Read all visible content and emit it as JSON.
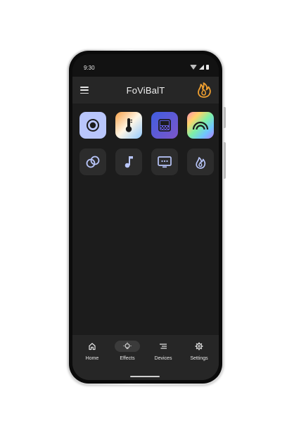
{
  "status_bar": {
    "time": "9:30",
    "icons": [
      "wifi-icon",
      "signal-icon",
      "battery-icon"
    ]
  },
  "app_bar": {
    "title": "FoViBalT",
    "menu_icon": "menu-icon",
    "logo_icon": "flame-logo-icon"
  },
  "effects": [
    {
      "id": "static",
      "icon": "radio-target-icon"
    },
    {
      "id": "color-temperature",
      "icon": "thermometer-icon"
    },
    {
      "id": "gradient",
      "icon": "gradient-icon"
    },
    {
      "id": "rainbow",
      "icon": "rainbow-icon"
    },
    {
      "id": "rings",
      "icon": "rings-icon"
    },
    {
      "id": "music",
      "icon": "music-note-icon"
    },
    {
      "id": "screen-sync",
      "icon": "screen-icon"
    },
    {
      "id": "fire",
      "icon": "flame-icon"
    }
  ],
  "bottom_nav": {
    "items": [
      {
        "label": "Home",
        "icon": "home-icon",
        "active": false
      },
      {
        "label": "Effects",
        "icon": "bulb-icon",
        "active": true
      },
      {
        "label": "Devices",
        "icon": "devices-list-icon",
        "active": false
      },
      {
        "label": "Settings",
        "icon": "gear-icon",
        "active": false
      }
    ]
  },
  "colors": {
    "background": "#1c1c1c",
    "surface": "#262626",
    "tile_dark": "#2c2c2c",
    "accent_blue": "#b9c6fb",
    "logo_orange": "#f0a030"
  }
}
